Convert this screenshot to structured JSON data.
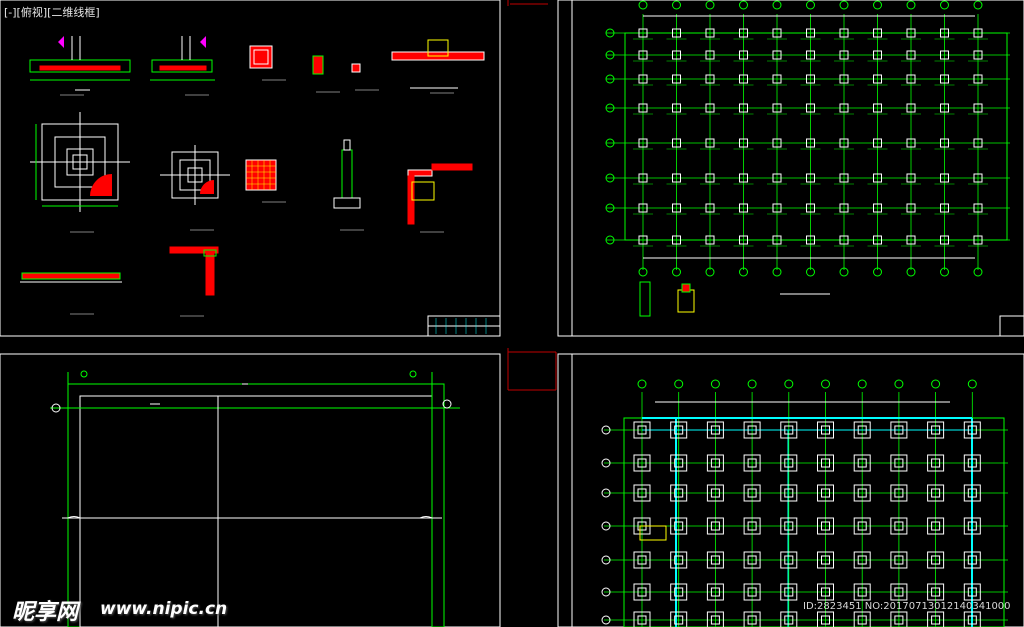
{
  "viewport": {
    "label": "[-][俯视][二维线框]"
  },
  "watermark": {
    "logo": "昵享网",
    "url": "www.nipic.cn",
    "id_text": "ID:2823451 NO:20170713012140341000"
  },
  "colors": {
    "background": "#000000",
    "frame": "#ffffff",
    "axis_line": "#00ff00",
    "beam": "#00ffff",
    "rebar": "#ff0000",
    "dimension": "#ffffff",
    "highlight": "#ffff00",
    "hatch": "#ff00ff"
  }
}
